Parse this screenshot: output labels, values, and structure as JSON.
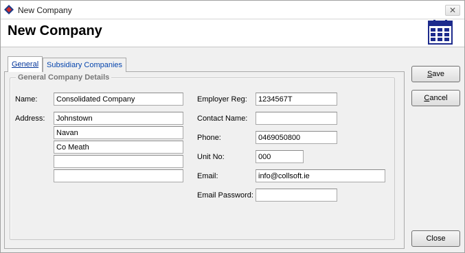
{
  "window": {
    "title": "New Company",
    "close_glyph": "✕"
  },
  "header": {
    "title": "New Company",
    "icon": "calendar-icon"
  },
  "tabs": [
    {
      "label": "General",
      "active": true
    },
    {
      "label": "Subsidiary Companies",
      "active": false
    }
  ],
  "group": {
    "title": "General Company Details"
  },
  "fields": {
    "name_label": "Name:",
    "name_value": "Consolidated Company",
    "address_label": "Address:",
    "address_lines": [
      "Johnstown",
      "Navan",
      "Co Meath",
      "",
      ""
    ],
    "employer_reg_label": "Employer Reg:",
    "employer_reg_value": "1234567T",
    "contact_name_label": "Contact Name:",
    "contact_name_value": "",
    "phone_label": "Phone:",
    "phone_value": "0469050800",
    "unit_no_label": "Unit No:",
    "unit_no_value": "000",
    "email_label": "Email:",
    "email_value": "info@collsoft.ie",
    "email_password_label": "Email Password:",
    "email_password_value": ""
  },
  "buttons": {
    "save_prefix": "",
    "save_mnemonic": "S",
    "save_rest": "ave",
    "cancel_prefix": "",
    "cancel_mnemonic": "C",
    "cancel_rest": "ancel",
    "close_label": "Close"
  },
  "colors": {
    "tab_text": "#0645ad",
    "group_title": "#777777",
    "calendar_blue": "#1c2a8c"
  }
}
